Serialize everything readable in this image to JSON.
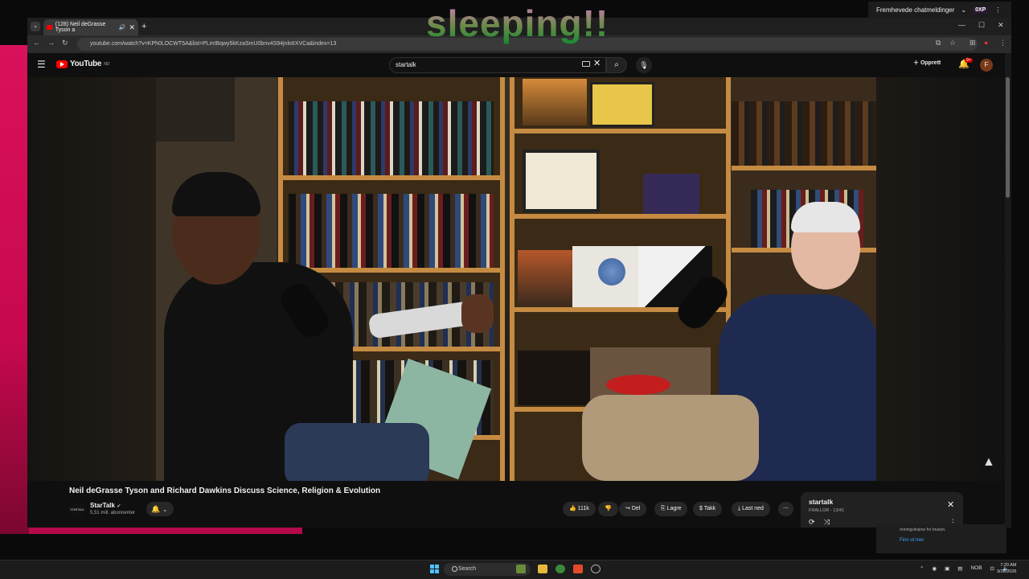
{
  "overlay_text": "sleeping!!",
  "browser": {
    "tab_title": "(128) Neil deGrasse Tyson a",
    "url": "youtube.com/watch?v=KPh0LOCWT5A&list=PLmIBqwy5kKzaSmU0bnv4S94jnlotIXVCa&index=13",
    "chat_button": "Fremhevede chatmeldinger",
    "oxp_badge": "0XP"
  },
  "youtube": {
    "logo_text": "YouTube",
    "logo_sup": "NO",
    "search_value": "startalk",
    "create_label": "Opprett",
    "notif_count": "9+",
    "avatar_letter": "F"
  },
  "video": {
    "title": "Neil deGrasse Tyson and Richard Dawkins Discuss Science, Religion & Evolution",
    "channel_name": "StarTalk",
    "channel_avatar_text": "STARTALK",
    "subscribers": "5,51 mill. abonnenter",
    "likes": "111k",
    "share": "Del",
    "save": "Lagre",
    "thanks": "Takk",
    "download": "Last ned"
  },
  "playlist": {
    "title": "startalk",
    "meta": "FRALLOR - 13/41"
  },
  "notification": {
    "text": "retningslinjene for bruken.",
    "link": "Finn ut mer"
  },
  "taskbar": {
    "search_label": "Search",
    "lang": "NOB",
    "time": "7:20 AM",
    "date": "3/26/2026"
  }
}
